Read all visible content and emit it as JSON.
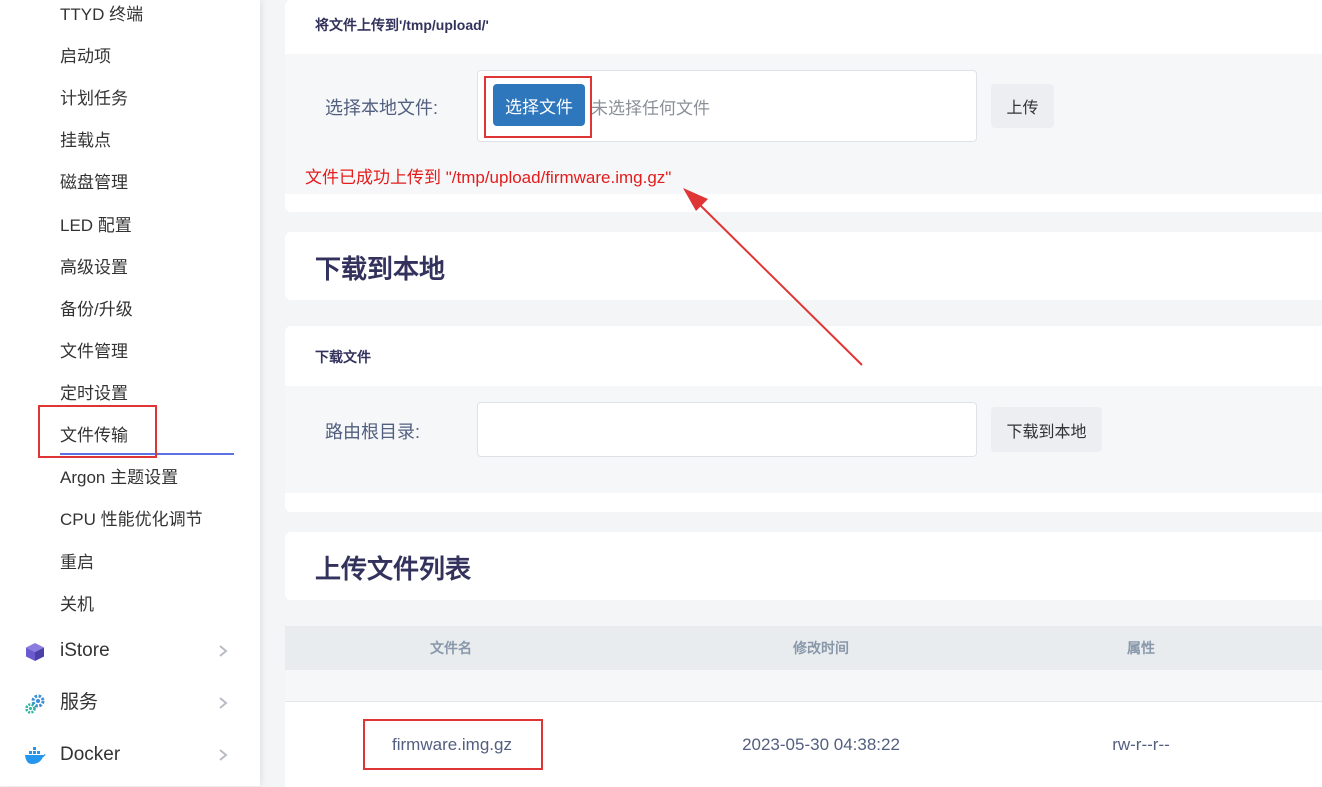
{
  "sidebar": {
    "sub_items": [
      "TTYD 终端",
      "启动项",
      "计划任务",
      "挂载点",
      "磁盘管理",
      "LED 配置",
      "高级设置",
      "备份/升级",
      "文件管理",
      "定时设置",
      "文件传输",
      "Argon 主题设置",
      "CPU 性能优化调节",
      "重启",
      "关机"
    ],
    "active_item": "文件传输",
    "top_items": [
      {
        "label": "iStore",
        "icon": "cube-icon"
      },
      {
        "label": "服务",
        "icon": "gears-icon"
      },
      {
        "label": "Docker",
        "icon": "docker-whale-icon"
      }
    ]
  },
  "upload": {
    "section_subtitle": "将文件上传到'/tmp/upload/'",
    "label": "选择本地文件:",
    "choose_button": "选择文件",
    "no_file_text": "未选择任何文件",
    "upload_button": "上传",
    "success_message": "文件已成功上传到 \"/tmp/upload/firmware.img.gz\""
  },
  "download": {
    "title": "下载到本地",
    "section_subtitle": "下载文件",
    "label": "路由根目录:",
    "path_value": "",
    "download_button": "下载到本地"
  },
  "file_list": {
    "title": "上传文件列表",
    "columns": [
      "文件名",
      "修改时间",
      "属性"
    ],
    "rows": [
      {
        "name": "firmware.img.gz",
        "mtime": "2023-05-30 04:38:22",
        "attr": "rw-r--r--"
      }
    ]
  },
  "colors": {
    "accent": "#5e72e4",
    "primary_button": "#2e77bc",
    "annotation_red": "#e03535",
    "success_text": "#e41c1c"
  }
}
